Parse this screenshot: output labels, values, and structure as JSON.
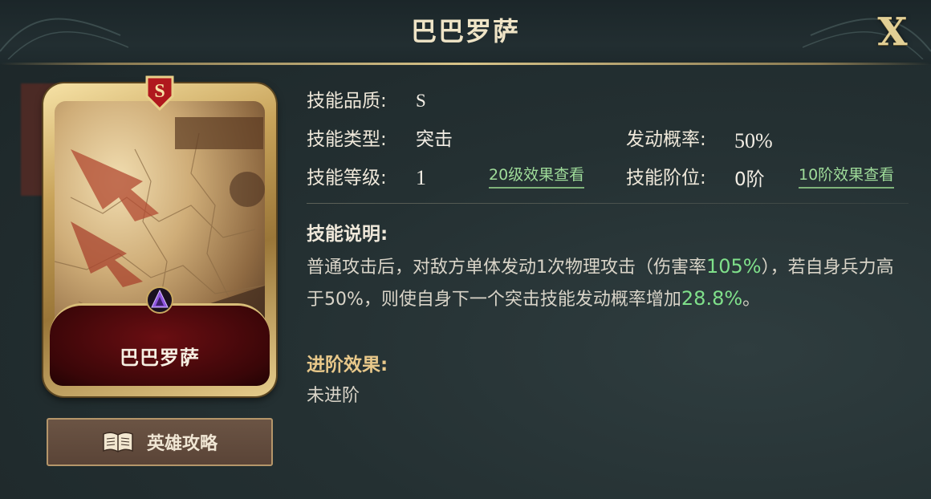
{
  "header": {
    "title": "巴巴罗萨",
    "close_label": "X"
  },
  "card": {
    "grade": "S",
    "name": "巴巴罗萨",
    "art": "map-with-arrows",
    "gem_icon": "purple-gem-icon"
  },
  "guide_button": {
    "label": "英雄攻略",
    "icon": "book-icon"
  },
  "skill": {
    "quality_label": "技能品质:",
    "quality_value": "S",
    "type_label": "技能类型:",
    "type_value": "突击",
    "level_label": "技能等级:",
    "level_value": "1",
    "level_link": "20级效果查看",
    "trigger_label": "发动概率:",
    "trigger_value": "50%",
    "rank_label": "技能阶位:",
    "rank_value": "0阶",
    "rank_link": "10阶效果查看"
  },
  "description": {
    "heading": "技能说明:",
    "part1": "普通攻击后，对敌方单体发动1次物理攻击（伤害率",
    "hl1": "105%",
    "part2": "），若自身兵力高于50%，则使自身下一个突击技能发动概率增加",
    "hl2": "28.8%",
    "part3": "。"
  },
  "advancement": {
    "heading": "进阶效果:",
    "value": "未进阶"
  },
  "colors": {
    "highlight": "#7fe08a",
    "gold": "#e2cf95",
    "section_heading": "#e8c88a"
  }
}
